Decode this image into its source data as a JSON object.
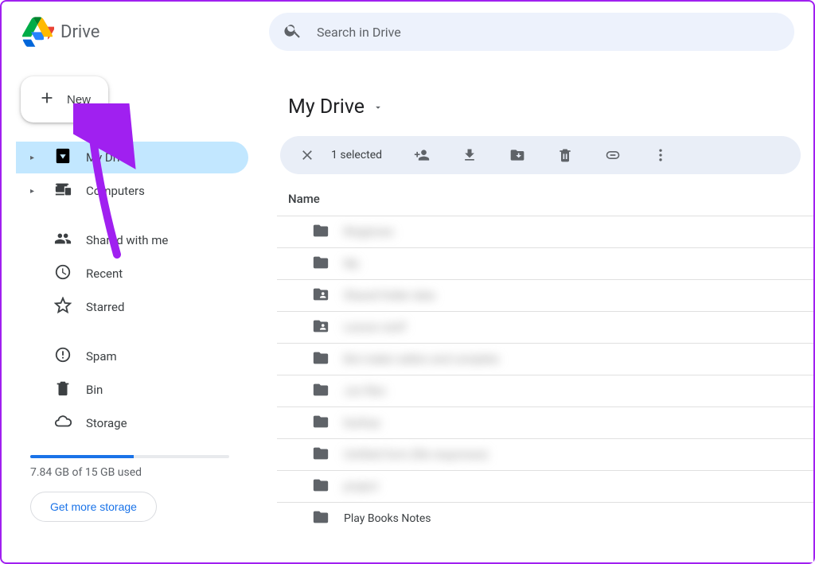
{
  "app_name": "Drive",
  "search_placeholder": "Search in Drive",
  "new_button_label": "New",
  "sidebar": {
    "items": [
      {
        "label": "My Drive",
        "icon": "drive",
        "expandable": true,
        "active": true
      },
      {
        "label": "Computers",
        "icon": "devices",
        "expandable": true,
        "active": false
      },
      {
        "label": "Shared with me",
        "icon": "people",
        "expandable": false,
        "active": false
      },
      {
        "label": "Recent",
        "icon": "clock",
        "expandable": false,
        "active": false
      },
      {
        "label": "Starred",
        "icon": "star",
        "expandable": false,
        "active": false
      },
      {
        "label": "Spam",
        "icon": "alert",
        "expandable": false,
        "active": false
      },
      {
        "label": "Bin",
        "icon": "trash",
        "expandable": false,
        "active": false
      },
      {
        "label": "Storage",
        "icon": "cloud",
        "expandable": false,
        "active": false
      }
    ]
  },
  "storage": {
    "percent": 52,
    "used_text": "7.84 GB of 15 GB used",
    "cta": "Get more storage"
  },
  "breadcrumb_title": "My Drive",
  "action_bar": {
    "selected_label": "1 selected"
  },
  "column_header": "Name",
  "files": [
    {
      "icon": "folder",
      "name": "Ringtones",
      "blurred": true
    },
    {
      "icon": "folder",
      "name": "My",
      "blurred": true
    },
    {
      "icon": "folder-shared",
      "name": "Shared folder data",
      "blurred": true
    },
    {
      "icon": "folder-shared",
      "name": "Lesson stuff",
      "blurred": true
    },
    {
      "icon": "folder",
      "name": "Bot maker addon and complete",
      "blurred": true
    },
    {
      "icon": "folder",
      "name": "Jun files",
      "blurred": true
    },
    {
      "icon": "folder",
      "name": "backup",
      "blurred": true
    },
    {
      "icon": "folder",
      "name": "Untitled form (file responses)",
      "blurred": true
    },
    {
      "icon": "folder",
      "name": "project",
      "blurred": true
    },
    {
      "icon": "folder",
      "name": "Play Books Notes",
      "blurred": false
    }
  ],
  "colors": {
    "accent": "#1a73e8",
    "active_pill": "#c2e7ff",
    "arrow": "#a020f0"
  }
}
